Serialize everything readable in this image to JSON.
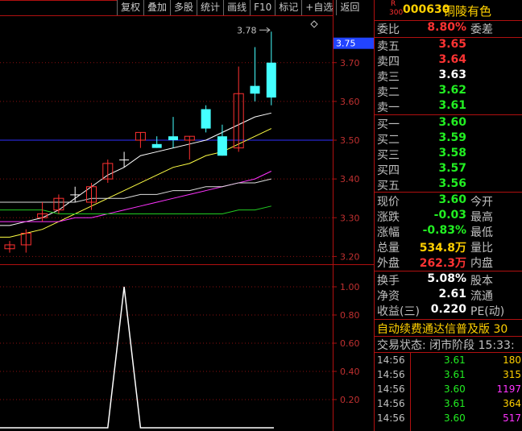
{
  "toolbar": [
    "复权",
    "叠加",
    "多股",
    "统计",
    "画线",
    "F10",
    "标记",
    "+自选",
    "返回"
  ],
  "header": {
    "r": "R",
    "sub": "300",
    "code": "000630",
    "name": "铜陵有色"
  },
  "ratio": {
    "label": "委比",
    "value": "8.80%",
    "label2": "委差"
  },
  "asks": [
    {
      "label": "卖五",
      "price": "3.65",
      "color": "red"
    },
    {
      "label": "卖四",
      "price": "3.64",
      "color": "red"
    },
    {
      "label": "卖三",
      "price": "3.63",
      "color": "white"
    },
    {
      "label": "卖二",
      "price": "3.62",
      "color": "green"
    },
    {
      "label": "卖一",
      "price": "3.61",
      "color": "green"
    }
  ],
  "bids": [
    {
      "label": "买一",
      "price": "3.60",
      "color": "green"
    },
    {
      "label": "买二",
      "price": "3.59",
      "color": "green"
    },
    {
      "label": "买三",
      "price": "3.58",
      "color": "green"
    },
    {
      "label": "买四",
      "price": "3.57",
      "color": "green"
    },
    {
      "label": "买五",
      "price": "3.56",
      "color": "green"
    }
  ],
  "quote": [
    {
      "label": "现价",
      "value": "3.60",
      "color": "green",
      "label2": "今开"
    },
    {
      "label": "涨跌",
      "value": "-0.03",
      "color": "green",
      "label2": "最高"
    },
    {
      "label": "涨幅",
      "value": "-0.83%",
      "color": "green",
      "label2": "最低"
    },
    {
      "label": "总量",
      "value": "534.8万",
      "color": "yellow",
      "label2": "量比"
    },
    {
      "label": "外盘",
      "value": "262.3万",
      "color": "red",
      "label2": "内盘"
    }
  ],
  "extra": [
    {
      "label": "换手",
      "value": "5.08%",
      "label2": "股本"
    },
    {
      "label": "净资",
      "value": "2.61",
      "label2": "流通"
    },
    {
      "label": "收益(三)",
      "value": "0.220",
      "label2": "PE(动)"
    }
  ],
  "banner": "自动续费通达信普及版  30",
  "status": "交易状态: 闭市阶段 15:33:",
  "ticks": [
    {
      "time": "14:56",
      "price": "3.61",
      "pcolor": "green",
      "vol": "180",
      "vcolor": "yellow"
    },
    {
      "time": "14:56",
      "price": "3.61",
      "pcolor": "green",
      "vol": "315",
      "vcolor": "yellow"
    },
    {
      "time": "14:56",
      "price": "3.60",
      "pcolor": "green",
      "vol": "1197",
      "vcolor": "mag"
    },
    {
      "time": "14:56",
      "price": "3.61",
      "pcolor": "green",
      "vol": "364",
      "vcolor": "yellow"
    },
    {
      "time": "14:56",
      "price": "3.60",
      "pcolor": "green",
      "vol": "517",
      "vcolor": "mag"
    }
  ],
  "chart_data": {
    "type": "candlestick",
    "price_axis": [
      "3.70",
      "3.60",
      "3.50",
      "3.40",
      "3.30",
      "3.20"
    ],
    "price_ylim": [
      3.18,
      3.82
    ],
    "current_price_label": "3.75",
    "high_annotation": "3.78",
    "indicator_axis": [
      "1.00",
      "0.80",
      "0.60",
      "0.40",
      "0.20"
    ],
    "indicator_ylim": [
      0,
      1.12
    ],
    "candles": [
      {
        "o": 3.22,
        "c": 3.23,
        "h": 3.24,
        "l": 3.21,
        "color": "red"
      },
      {
        "o": 3.23,
        "c": 3.26,
        "h": 3.27,
        "l": 3.21,
        "color": "red"
      },
      {
        "o": 3.3,
        "c": 3.31,
        "h": 3.34,
        "l": 3.29,
        "color": "red"
      },
      {
        "o": 3.32,
        "c": 3.35,
        "h": 3.36,
        "l": 3.31,
        "color": "red"
      },
      {
        "o": 3.36,
        "c": 3.36,
        "h": 3.38,
        "l": 3.34,
        "color": "white"
      },
      {
        "o": 3.34,
        "c": 3.38,
        "h": 3.39,
        "l": 3.32,
        "color": "red"
      },
      {
        "o": 3.4,
        "c": 3.44,
        "h": 3.45,
        "l": 3.39,
        "color": "red"
      },
      {
        "o": 3.45,
        "c": 3.45,
        "h": 3.47,
        "l": 3.43,
        "color": "white"
      },
      {
        "o": 3.5,
        "c": 3.52,
        "h": 3.52,
        "l": 3.48,
        "color": "red"
      },
      {
        "o": 3.49,
        "c": 3.48,
        "h": 3.51,
        "l": 3.48,
        "color": "cyan"
      },
      {
        "o": 3.5,
        "c": 3.51,
        "h": 3.56,
        "l": 3.48,
        "color": "cyan"
      },
      {
        "o": 3.5,
        "c": 3.51,
        "h": 3.51,
        "l": 3.45,
        "color": "red"
      },
      {
        "o": 3.58,
        "c": 3.53,
        "h": 3.59,
        "l": 3.52,
        "color": "cyan"
      },
      {
        "o": 3.51,
        "c": 3.46,
        "h": 3.54,
        "l": 3.46,
        "color": "cyan"
      },
      {
        "o": 3.48,
        "c": 3.62,
        "h": 3.69,
        "l": 3.47,
        "color": "red"
      },
      {
        "o": 3.64,
        "c": 3.62,
        "h": 3.74,
        "l": 3.6,
        "color": "cyan"
      },
      {
        "o": 3.7,
        "c": 3.61,
        "h": 3.78,
        "l": 3.59,
        "color": "cyan"
      }
    ],
    "ma": [
      {
        "color": "#ffffff",
        "values": [
          3.28,
          3.29,
          3.3,
          3.32,
          3.35,
          3.38,
          3.41,
          3.43,
          3.46,
          3.47,
          3.48,
          3.49,
          3.5,
          3.52,
          3.54,
          3.56,
          3.57
        ]
      },
      {
        "color": "#ffff44",
        "values": [
          3.25,
          3.26,
          3.27,
          3.29,
          3.31,
          3.33,
          3.35,
          3.37,
          3.39,
          3.41,
          3.43,
          3.44,
          3.46,
          3.47,
          3.49,
          3.51,
          3.53
        ]
      },
      {
        "color": "#ff33ff",
        "values": [
          3.29,
          3.29,
          3.29,
          3.29,
          3.3,
          3.3,
          3.31,
          3.32,
          3.33,
          3.34,
          3.35,
          3.36,
          3.37,
          3.38,
          3.39,
          3.4,
          3.42
        ]
      },
      {
        "color": "#dddddd",
        "values": [
          3.34,
          3.34,
          3.34,
          3.34,
          3.34,
          3.35,
          3.35,
          3.35,
          3.36,
          3.36,
          3.37,
          3.37,
          3.38,
          3.38,
          3.39,
          3.39,
          3.4
        ]
      },
      {
        "color": "#22cc22",
        "values": [
          3.32,
          3.32,
          3.32,
          3.31,
          3.31,
          3.31,
          3.31,
          3.31,
          3.31,
          3.31,
          3.31,
          3.31,
          3.31,
          3.31,
          3.32,
          3.32,
          3.33
        ]
      }
    ],
    "ref_line": 3.5,
    "indicator": [
      0,
      0,
      0,
      0,
      0,
      0,
      0,
      1.0,
      0,
      0,
      0,
      0,
      0,
      0,
      0,
      0,
      0
    ]
  }
}
